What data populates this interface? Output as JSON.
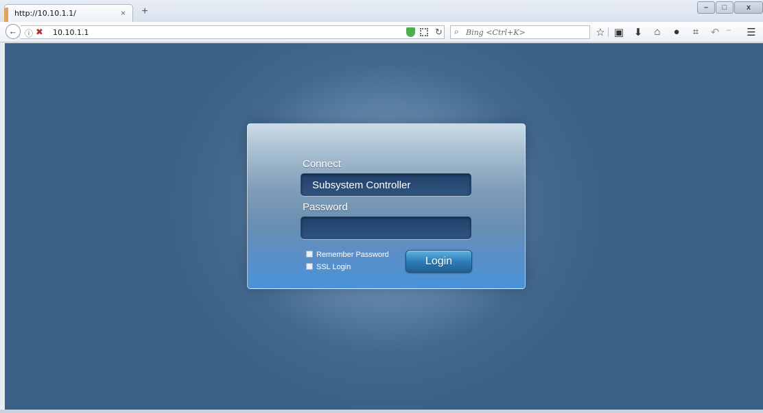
{
  "browser": {
    "tab": {
      "title": "http://10.10.1.1/",
      "close": "×"
    },
    "new_tab": "+",
    "url": "10.10.1.1",
    "search_placeholder": "Bing <Ctrl+K>",
    "window_controls": {
      "minimize": "–",
      "maximize": "□",
      "close": "x"
    }
  },
  "login": {
    "connect_label": "Connect",
    "connect_value": "Subsystem Controller",
    "password_label": "Password",
    "password_value": "",
    "remember_label": "Remember Password",
    "ssl_label": "SSL Login",
    "login_button": "Login"
  },
  "colors": {
    "page_bg": "#3a6188",
    "panel_accent": "#4a93d8"
  }
}
